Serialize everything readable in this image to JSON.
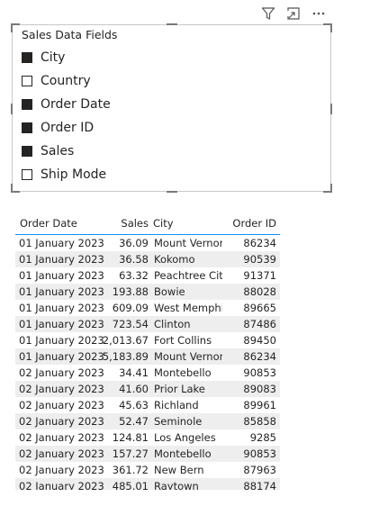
{
  "toolbar": {
    "icons": [
      "filter-icon",
      "focus-mode-icon",
      "more-options-icon"
    ]
  },
  "slicer": {
    "title": "Sales Data Fields",
    "items": [
      {
        "label": "City",
        "checked": true
      },
      {
        "label": "Country",
        "checked": false
      },
      {
        "label": "Order Date",
        "checked": true
      },
      {
        "label": "Order ID",
        "checked": true
      },
      {
        "label": "Sales",
        "checked": true
      },
      {
        "label": "Ship Mode",
        "checked": false
      }
    ]
  },
  "table": {
    "headers": [
      "Order Date",
      "Sales",
      "City",
      "Order ID"
    ],
    "rows": [
      [
        "01 January 2023",
        "36.09",
        "Mount Vernon",
        "86234"
      ],
      [
        "01 January 2023",
        "36.58",
        "Kokomo",
        "90539"
      ],
      [
        "01 January 2023",
        "63.32",
        "Peachtree City",
        "91371"
      ],
      [
        "01 January 2023",
        "193.88",
        "Bowie",
        "88028"
      ],
      [
        "01 January 2023",
        "609.09",
        "West Memphis",
        "89665"
      ],
      [
        "01 January 2023",
        "723.54",
        "Clinton",
        "87486"
      ],
      [
        "01 January 2023",
        "2,013.67",
        "Fort Collins",
        "89450"
      ],
      [
        "01 January 2023",
        "5,183.89",
        "Mount Vernon",
        "86234"
      ],
      [
        "02 January 2023",
        "34.41",
        "Montebello",
        "90853"
      ],
      [
        "02 January 2023",
        "41.60",
        "Prior Lake",
        "89083"
      ],
      [
        "02 January 2023",
        "45.63",
        "Richland",
        "89961"
      ],
      [
        "02 January 2023",
        "52.47",
        "Seminole",
        "85858"
      ],
      [
        "02 January 2023",
        "124.81",
        "Los Angeles",
        "9285"
      ],
      [
        "02 January 2023",
        "157.27",
        "Montebello",
        "90853"
      ],
      [
        "02 January 2023",
        "361.72",
        "New Bern",
        "87963"
      ],
      [
        "02 January 2023",
        "485.01",
        "Raytown",
        "88174"
      ]
    ]
  }
}
